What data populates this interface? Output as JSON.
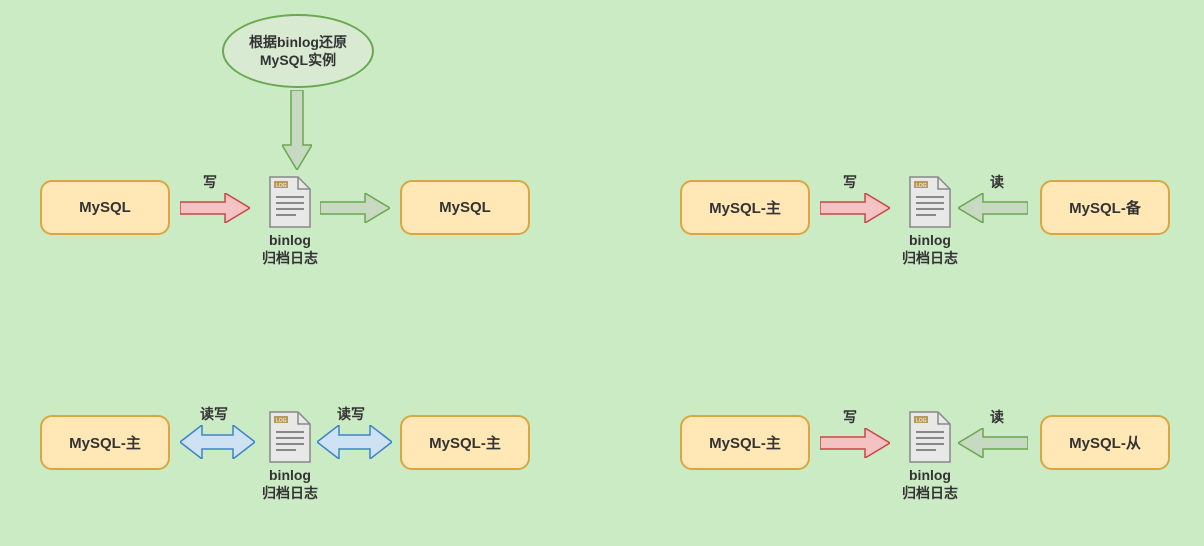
{
  "ellipse": {
    "text": "根据binlog还原\nMySQL实例"
  },
  "binlog": {
    "name": "binlog",
    "desc": "归档日志"
  },
  "labels": {
    "write": "写",
    "read": "读",
    "rw": "读写"
  },
  "boxes": {
    "mysql": "MySQL",
    "mysql_primary": "MySQL-主",
    "mysql_standby": "MySQL-备",
    "mysql_slave": "MySQL-从"
  }
}
